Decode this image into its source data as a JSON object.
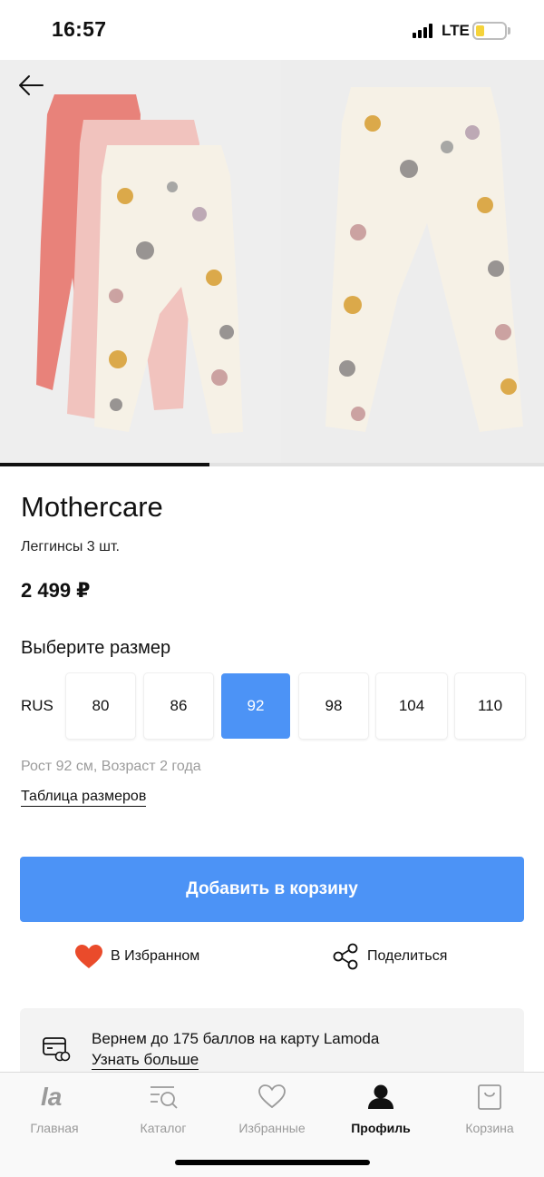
{
  "status_bar": {
    "time": "16:57",
    "network": "LTE",
    "signal_icon": "signal-bars-icon",
    "battery_icon": "battery-low-icon",
    "battery_level": 0.25,
    "battery_color": "#f5d33b"
  },
  "gallery": {
    "back_icon": "arrow-left-icon",
    "images": [
      {
        "alt": "leggings-three-pack-photo"
      },
      {
        "alt": "printed-leggings-back-photo"
      }
    ],
    "progress": 0.385
  },
  "product": {
    "brand": "Mothercare",
    "name": "Леггинсы 3 шт.",
    "price": "2 499 ₽"
  },
  "size_picker": {
    "title": "Выберите размер",
    "scale": "RUS",
    "sizes": [
      "80",
      "86",
      "92",
      "98",
      "104",
      "110"
    ],
    "selected": "92",
    "hint": "Рост 92 см, Возраст 2 года",
    "table_link": "Таблица размеров"
  },
  "actions": {
    "add_to_cart": "Добавить в корзину",
    "favorite": "В Избранном",
    "favorite_icon": "heart-filled-icon",
    "share": "Поделиться",
    "share_icon": "share-icon"
  },
  "loyalty": {
    "icon": "card-coins-icon",
    "text": "Вернем до 175 баллов на карту Lamoda",
    "link": "Узнать больше"
  },
  "tab_bar": {
    "items": [
      {
        "label": "Главная",
        "icon": "lamoda-logo-icon",
        "active": false
      },
      {
        "label": "Каталог",
        "icon": "catalog-search-icon",
        "active": false
      },
      {
        "label": "Избранные",
        "icon": "heart-outline-icon",
        "active": false
      },
      {
        "label": "Профиль",
        "icon": "profile-icon",
        "active": true
      },
      {
        "label": "Корзина",
        "icon": "shopping-bag-icon",
        "active": false
      }
    ]
  },
  "colors": {
    "accent": "#4c93f6",
    "heart": "#ea4b2b",
    "muted_text": "#9c9c9c"
  }
}
